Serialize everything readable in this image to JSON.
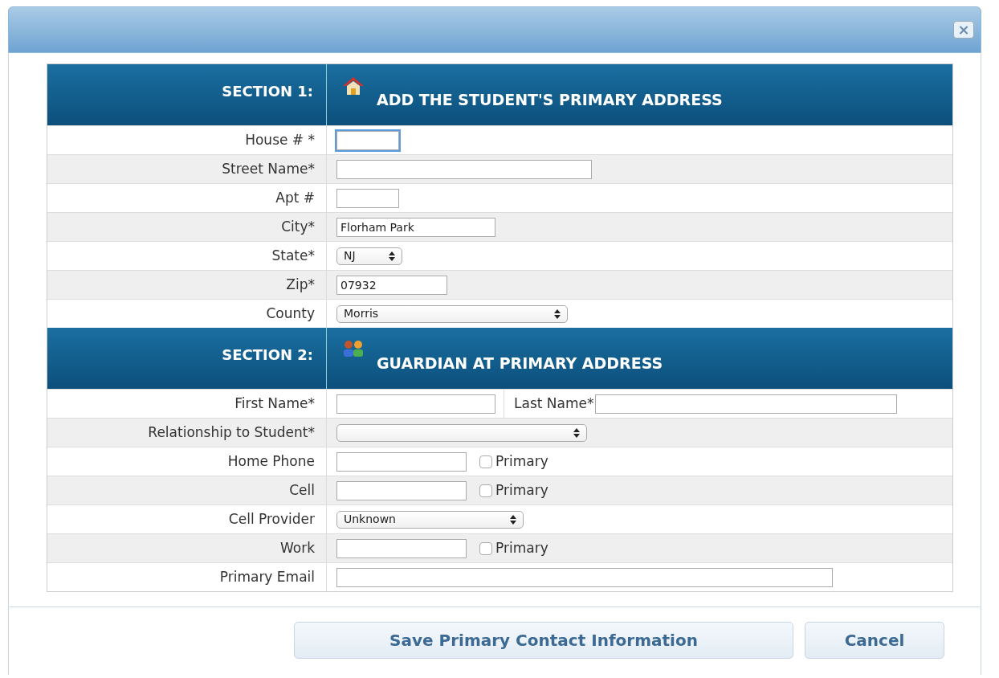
{
  "close_button": "×",
  "sections": [
    {
      "label": "SECTION 1:",
      "title": "ADD THE STUDENT'S PRIMARY ADDRESS",
      "rows": [
        {
          "kind": "text",
          "label": "House # *",
          "value": "",
          "focused": true
        },
        {
          "kind": "text",
          "label": "Street Name*",
          "value": "",
          "focused": false
        },
        {
          "kind": "text",
          "label": "Apt #",
          "value": "",
          "focused": false
        },
        {
          "kind": "text",
          "label": "City*",
          "value": "Florham Park",
          "focused": false
        },
        {
          "kind": "select",
          "label": "State*",
          "value": "NJ"
        },
        {
          "kind": "text",
          "label": "Zip*",
          "value": "07932",
          "focused": false
        },
        {
          "kind": "select",
          "label": "County",
          "value": "Morris"
        }
      ]
    },
    {
      "label": "SECTION 2:",
      "title": "GUARDIAN AT PRIMARY ADDRESS",
      "rows": [
        {
          "kind": "name_pair",
          "label": "First Name*",
          "second_label": "Last Name*"
        },
        {
          "kind": "select",
          "label": "Relationship to Student*"
        },
        {
          "kind": "phone",
          "label": "Home Phone",
          "checkbox_label": "Primary",
          "checked": false
        },
        {
          "kind": "phone",
          "label": "Cell",
          "checkbox_label": "Primary",
          "checked": false
        },
        {
          "kind": "select",
          "label": "Cell Provider",
          "value": "Unknown"
        },
        {
          "kind": "phone",
          "label": "Work",
          "checkbox_label": "Primary",
          "checked": false
        },
        {
          "kind": "text",
          "label": "Primary Email",
          "value": "",
          "focused": false
        }
      ]
    }
  ],
  "buttons": [
    "Save Primary Contact Information",
    "Cancel"
  ]
}
